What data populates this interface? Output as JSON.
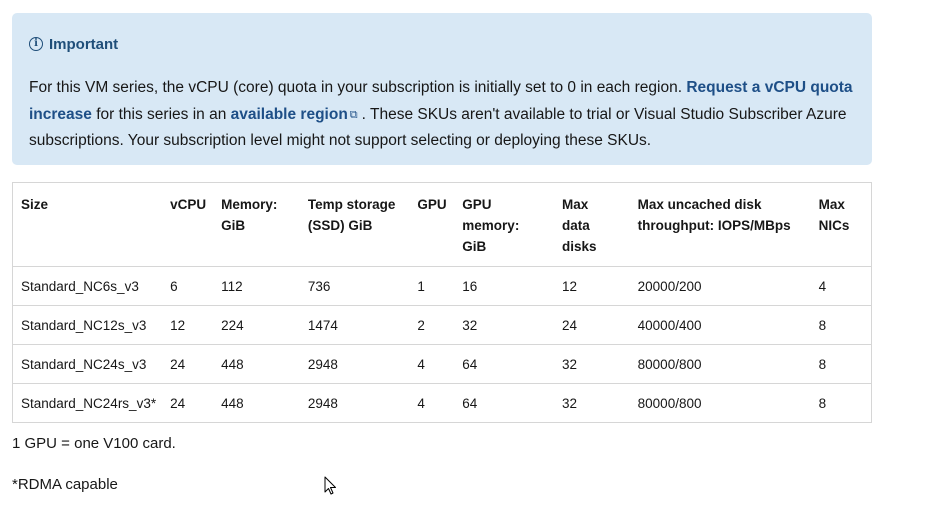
{
  "alert": {
    "title": "Important",
    "text_1": "For this VM series, the vCPU (core) quota in your subscription is initially set to 0 in each region. ",
    "link_1": "Request a vCPU quota increase",
    "text_2": " for this series in an ",
    "link_2": "available region",
    "text_3": ". These SKUs aren't available to trial or Visual Studio Subscriber Azure subscriptions. Your subscription level might not support selecting or deploying these SKUs."
  },
  "table": {
    "headers": {
      "size": "Size",
      "vcpu": "vCPU",
      "memory_a": "Memory:",
      "memory_b": "GiB",
      "temp_a": "Temp storage",
      "temp_b": "(SSD) GiB",
      "gpu": "GPU",
      "gpumem_a": "GPU",
      "gpumem_b": "memory:",
      "gpumem_c": "GiB",
      "disks_a": "Max",
      "disks_b": "data",
      "disks_c": "disks",
      "throughput_a": "Max uncached disk",
      "throughput_b": "throughput: IOPS/MBps",
      "nics_a": "Max",
      "nics_b": "NICs"
    },
    "rows": [
      {
        "size": "Standard_NC6s_v3",
        "vcpu": "6",
        "memory": "112",
        "temp": "736",
        "gpu": "1",
        "gpumem": "16",
        "disks": "12",
        "throughput": "20000/200",
        "nics": "4"
      },
      {
        "size": "Standard_NC12s_v3",
        "vcpu": "12",
        "memory": "224",
        "temp": "1474",
        "gpu": "2",
        "gpumem": "32",
        "disks": "24",
        "throughput": "40000/400",
        "nics": "8"
      },
      {
        "size": "Standard_NC24s_v3",
        "vcpu": "24",
        "memory": "448",
        "temp": "2948",
        "gpu": "4",
        "gpumem": "64",
        "disks": "32",
        "throughput": "80000/800",
        "nics": "8"
      },
      {
        "size": "Standard_NC24rs_v3*",
        "vcpu": "24",
        "memory": "448",
        "temp": "2948",
        "gpu": "4",
        "gpumem": "64",
        "disks": "32",
        "throughput": "80000/800",
        "nics": "8"
      }
    ]
  },
  "notes": {
    "gpu_note": "1 GPU = one V100 card.",
    "rdma_note": "*RDMA capable"
  },
  "colors": {
    "alert_bg": "#d8e8f5",
    "link": "#1e4f87",
    "border": "#d6d6d6"
  }
}
